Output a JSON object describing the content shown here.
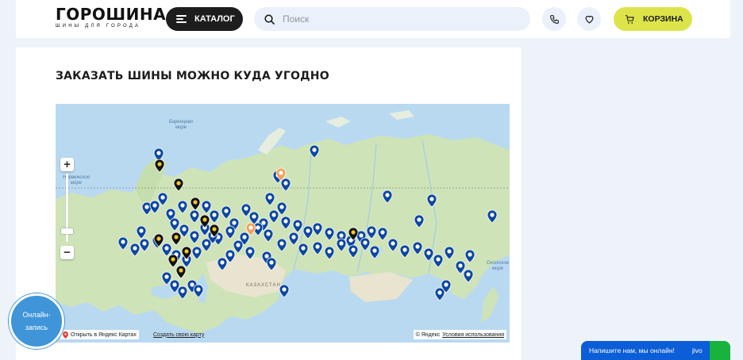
{
  "header": {
    "logo_main": "ГОРОШИНА",
    "logo_sub": "ШИНЫ ДЛЯ ГОРОДА",
    "catalog_label": "КАТАЛОГ",
    "search_placeholder": "Поиск",
    "cart_label": "КОРЗИНА"
  },
  "section": {
    "title": "ЗАКАЗАТЬ ШИНЫ МОЖНО КУДА УГОДНО"
  },
  "map": {
    "sea_barents": "Баренцево море",
    "sea_okhotsk": "Охотское море",
    "label_kazakhstan": "КАЗАХСТАН",
    "label_norway": "Норвежское море",
    "open_link": "Открыть в Яндекс Картах",
    "create_link": "Создать свою карту",
    "copyright": "© Яндекс",
    "terms": "Условия использования",
    "zoom_in": "+",
    "zoom_out": "−",
    "colors": {
      "water": "#b9d9f0",
      "land": "#cfe3b8",
      "pin_blue": "#0d47a1",
      "pin_black": "#111111",
      "pin_orange": "#f0a35b"
    }
  },
  "widgets": {
    "online_line1": "Онлайн-",
    "online_line2": "запись",
    "jivo_text": "Напишите нам, мы онлайн!",
    "jivo_brand": "jivo"
  }
}
